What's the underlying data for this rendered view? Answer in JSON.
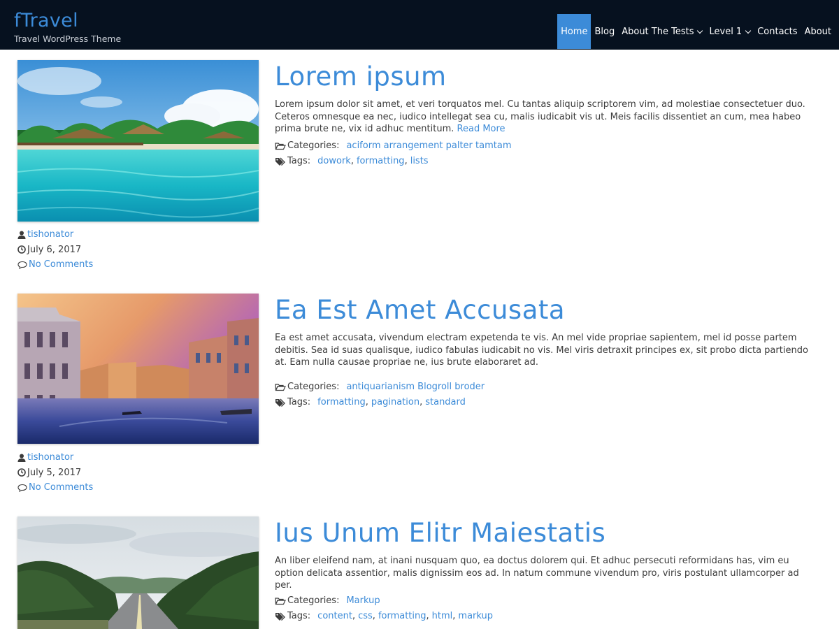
{
  "site": {
    "title": "fTravel",
    "description": "Travel WordPress Theme"
  },
  "nav": {
    "items": [
      {
        "label": "Home",
        "active": true,
        "dropdown": false
      },
      {
        "label": "Blog",
        "active": false,
        "dropdown": false
      },
      {
        "label": "About The Tests",
        "active": false,
        "dropdown": true
      },
      {
        "label": "Level 1",
        "active": false,
        "dropdown": true
      },
      {
        "label": "Contacts",
        "active": false,
        "dropdown": false
      },
      {
        "label": "About",
        "active": false,
        "dropdown": false
      }
    ]
  },
  "labels": {
    "categories": "Categories:",
    "tags": "Tags:"
  },
  "colors": {
    "header_bg": "#06111f",
    "accent": "#3c8bd8",
    "text": "#3b3b3b"
  },
  "posts": [
    {
      "title": "Lorem ipsum",
      "excerpt": "Lorem ipsum dolor sit amet, et veri torquatos mel. Cu tantas aliquip scriptorem vim, ad molestiae consectetuer duo. Ceteros omnesque ea nec, iudico intellegat sea cu, malis iudicabit vis ut. Meis facilis dissentiet an cum, mea habeo prima brute ne, vix id adhuc mentitum.",
      "read_more": "Read More",
      "categories": [
        "aciform arrangement palter tamtam"
      ],
      "tags": [
        "dowork",
        "formatting",
        "lists"
      ],
      "author": "tishonator",
      "date": "July 6, 2017",
      "comments": "No Comments",
      "image": "tropical-beach-resort"
    },
    {
      "title": "Ea Est Amet Accusata",
      "excerpt": "Ea est amet accusata, vivendum electram expetenda te vis. An mel vide propriae sapientem, mel id posse partem debitis. Sea id suas qualisque, iudico fabulas iudicabit no vis. Mel viris detraxit principes ex, sit probo dicta partiendo at. Eam nulla causae propriae ne, ius brute elaboraret ad.",
      "read_more": "",
      "categories": [
        "antiquarianism Blogroll broder"
      ],
      "tags": [
        "formatting",
        "pagination",
        "standard"
      ],
      "author": "tishonator",
      "date": "July 5, 2017",
      "comments": "No Comments",
      "image": "venice-canal-sunset"
    },
    {
      "title": "Ius Unum Elitr Maiestatis",
      "excerpt": "An liber eleifend nam, at inani nusquam quo, ea doctus dolorem qui. Et adhuc persecuti reformidans has, vim eu option delicata assentior, malis dignissim eos ad. In natum commune vivendum pro, viris postulant ullamcorper ad per.",
      "read_more": "",
      "categories": [
        "Markup"
      ],
      "tags": [
        "content",
        "css",
        "formatting",
        "html",
        "markup"
      ],
      "author": "",
      "date": "",
      "comments": "",
      "image": "mountain-road"
    }
  ]
}
